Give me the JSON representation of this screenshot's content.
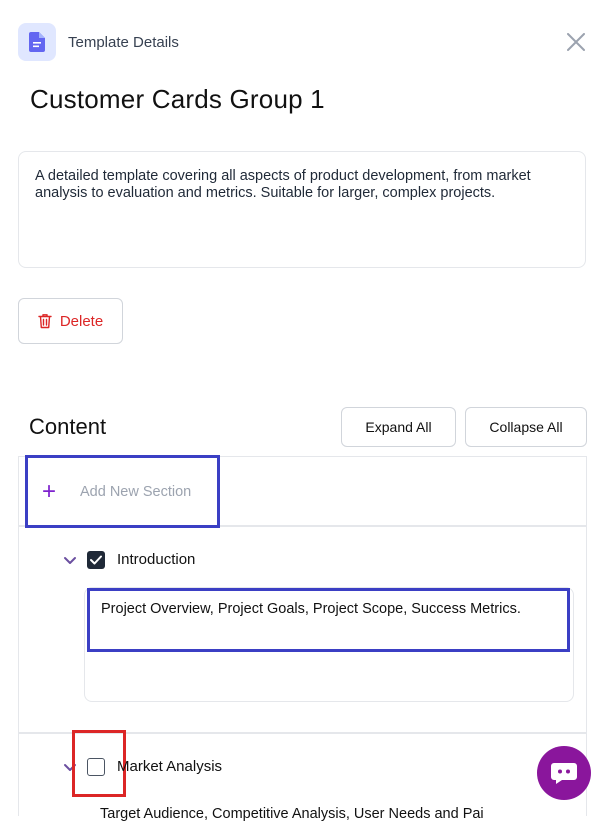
{
  "header": {
    "label": "Template Details",
    "icon": "document-icon",
    "close_icon": "close-icon"
  },
  "template": {
    "title": "Customer Cards Group 1",
    "description": "A detailed template covering all aspects of product development, from market analysis to evaluation and metrics. Suitable for larger, complex projects."
  },
  "actions": {
    "delete_label": "Delete",
    "delete_icon": "trash-icon"
  },
  "content": {
    "heading": "Content",
    "expand_all_label": "Expand All",
    "collapse_all_label": "Collapse All",
    "add_section_label": "Add New Section",
    "sections": [
      {
        "label": "Introduction",
        "checked": true,
        "items": "Project Overview, Project Goals, Project Scope, Success Metrics."
      },
      {
        "label": "Market Analysis",
        "checked": false,
        "items": "Target Audience, Competitive Analysis, User Needs and Pai"
      }
    ]
  },
  "chat": {
    "icon": "chat-bot-icon"
  },
  "colors": {
    "accent": "#8a169c",
    "danger": "#dc2626",
    "annotation": "#3b3fc4"
  }
}
